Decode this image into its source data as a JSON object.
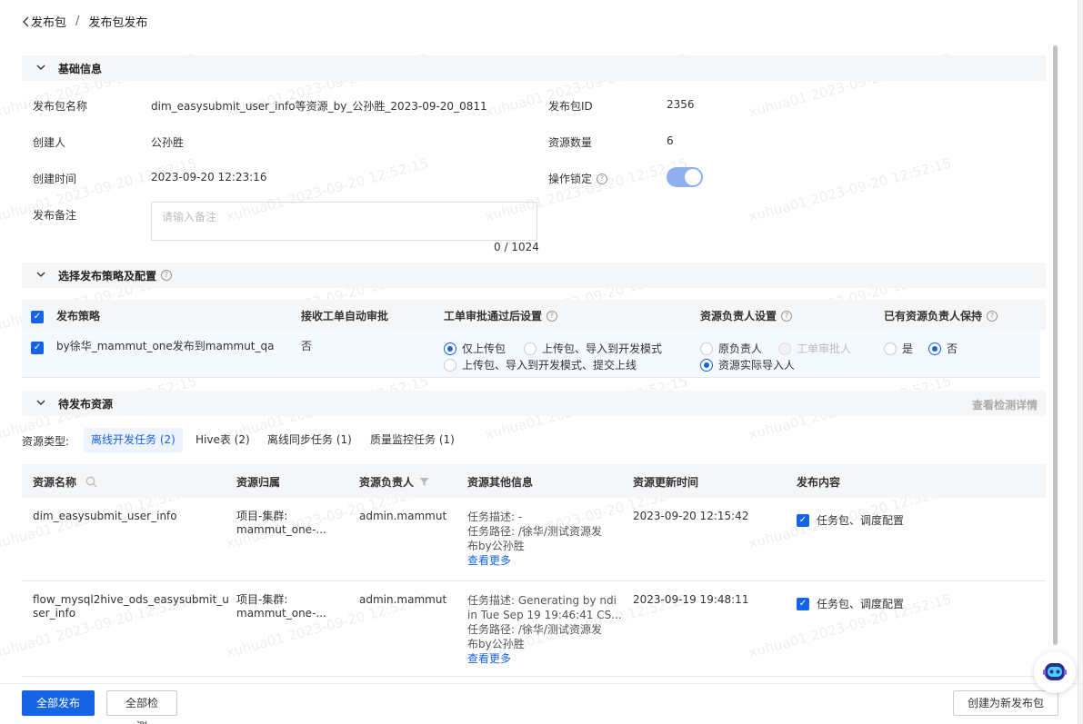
{
  "breadcrumb": {
    "back": "发布包",
    "separator": "/",
    "current": "发布包发布"
  },
  "basic_info": {
    "title": "基础信息",
    "package_name_label": "发布包名称",
    "package_name": "dim_easysubmit_user_info等资源_by_公孙胜_2023-09-20_0811",
    "package_id_label": "发布包ID",
    "package_id": "2356",
    "creator_label": "创建人",
    "creator": "公孙胜",
    "resource_count_label": "资源数量",
    "resource_count": "6",
    "created_time_label": "创建时间",
    "created_time": "2023-09-20 12:23:16",
    "lock_label": "操作锁定",
    "lock_on": true,
    "remark_label": "发布备注",
    "remark_placeholder": "请输入备注",
    "remark_counter": "0 / 1024"
  },
  "strategy": {
    "title": "选择发布策略及配置",
    "headers": {
      "policy": "发布策略",
      "auto_approve": "接收工单自动审批",
      "after_approve": "工单审批通过后设置",
      "owner_setting": "资源负责人设置",
      "keep_owner": "已有资源负责人保持"
    },
    "row": {
      "policy": "by徐华_mammut_one发布到mammut_qa",
      "auto_approve": "否",
      "after_approve_options": [
        "仅上传包",
        "上传包、导入到开发模式",
        "上传包、导入到开发模式、提交上线"
      ],
      "after_approve_selected": 0,
      "owner_options": [
        "原负责人",
        "工单审批人",
        "资源实际导入人"
      ],
      "owner_selected": 2,
      "keep_options": [
        "是",
        "否"
      ],
      "keep_selected": 1
    }
  },
  "pending": {
    "title": "待发布资源",
    "detail_link": "查看检测详情",
    "type_label": "资源类型:",
    "tabs": [
      "离线开发任务 (2)",
      "Hive表 (2)",
      "离线同步任务 (1)",
      "质量监控任务 (1)"
    ],
    "active_tab": 0,
    "columns": [
      "资源名称",
      "资源归属",
      "资源负责人",
      "资源其他信息",
      "资源更新时间",
      "发布内容"
    ],
    "rows": [
      {
        "name": "dim_easysubmit_user_info",
        "belong_1": "项目-集群:",
        "belong_2": "mammut_one-...",
        "owner": "admin.mammut",
        "desc": "任务描述: -",
        "path_1": "任务路径: /徐华/测试资源发",
        "path_2": "布by公孙胜",
        "more": "查看更多",
        "updated": "2023-09-20 12:15:42",
        "content": "任务包、调度配置"
      },
      {
        "name_1": "flow_mysql2hive_ods_easysubmit_u",
        "name_2": "ser_info",
        "belong_1": "项目-集群:",
        "belong_2": "mammut_one-...",
        "owner": "admin.mammut",
        "desc_1": "任务描述: Generating by ndi",
        "desc_2": "in Tue Sep 19 19:46:41 CS...",
        "path_1": "任务路径: /徐华/测试资源发",
        "path_2": "布by公孙胜",
        "more": "查看更多",
        "updated": "2023-09-19 19:48:11",
        "content": "任务包、调度配置"
      }
    ]
  },
  "footer": {
    "publish_all": "全部发布",
    "check_all": "全部检测",
    "create_new": "创建为新发布包"
  },
  "watermark": "xuhua01 2023-09-20 12:52:15",
  "colors": {
    "primary": "#1664e6",
    "header_bg": "#f5f6f8",
    "row_highlight": "#f4f8ff"
  },
  "icons": [
    "chevron-left-icon",
    "chevron-down-icon",
    "help-icon",
    "search-icon",
    "filter-icon",
    "checkbox-icon",
    "robot-icon"
  ]
}
